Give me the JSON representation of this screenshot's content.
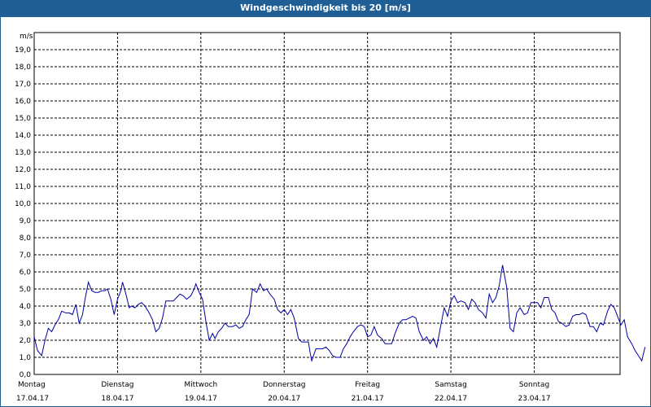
{
  "window": {
    "title": "Windgeschwindigkeit bis 20 [m/s]"
  },
  "chart_data": {
    "type": "line",
    "title": "Windgeschwindigkeit bis 20 [m/s]",
    "ylabel": "m/s",
    "ylim": [
      0,
      20
    ],
    "yticks": [
      "0,0",
      "1,0",
      "2,0",
      "3,0",
      "4,0",
      "5,0",
      "6,0",
      "7,0",
      "8,0",
      "9,0",
      "10,0",
      "11,0",
      "12,0",
      "13,0",
      "14,0",
      "15,0",
      "16,0",
      "17,0",
      "18,0",
      "19,0"
    ],
    "xlim": [
      0,
      7
    ],
    "grid": true,
    "days": [
      {
        "name": "Montag",
        "date": "17.04.17"
      },
      {
        "name": "Dienstag",
        "date": "18.04.17"
      },
      {
        "name": "Mittwoch",
        "date": "19.04.17"
      },
      {
        "name": "Donnerstag",
        "date": "20.04.17"
      },
      {
        "name": "Freitag",
        "date": "21.04.17"
      },
      {
        "name": "Samstag",
        "date": "22.04.17"
      },
      {
        "name": "Sonntag",
        "date": "23.04.17"
      }
    ],
    "series_color": "#0000a0",
    "series": [
      {
        "points": [
          [
            0.0,
            2.2
          ],
          [
            0.04,
            1.4
          ],
          [
            0.09,
            1.1
          ],
          [
            0.13,
            2.0
          ],
          [
            0.17,
            2.7
          ],
          [
            0.21,
            2.5
          ],
          [
            0.25,
            2.9
          ],
          [
            0.29,
            3.2
          ],
          [
            0.33,
            3.7
          ],
          [
            0.38,
            3.6
          ],
          [
            0.42,
            3.6
          ],
          [
            0.46,
            3.5
          ],
          [
            0.5,
            4.1
          ],
          [
            0.54,
            3.0
          ],
          [
            0.58,
            3.5
          ],
          [
            0.61,
            4.4
          ],
          [
            0.65,
            5.4
          ],
          [
            0.69,
            4.9
          ],
          [
            0.73,
            4.8
          ],
          [
            0.77,
            4.8
          ],
          [
            0.81,
            4.9
          ],
          [
            0.85,
            4.9
          ],
          [
            0.88,
            5.0
          ],
          [
            0.92,
            4.4
          ],
          [
            0.96,
            3.5
          ],
          [
            1.0,
            4.4
          ],
          [
            1.04,
            4.9
          ],
          [
            1.06,
            5.4
          ],
          [
            1.1,
            4.7
          ],
          [
            1.14,
            3.9
          ],
          [
            1.17,
            4.0
          ],
          [
            1.21,
            3.9
          ],
          [
            1.25,
            4.1
          ],
          [
            1.29,
            4.2
          ],
          [
            1.33,
            4.0
          ],
          [
            1.38,
            3.6
          ],
          [
            1.42,
            3.2
          ],
          [
            1.46,
            2.5
          ],
          [
            1.5,
            2.7
          ],
          [
            1.54,
            3.3
          ],
          [
            1.58,
            4.3
          ],
          [
            1.63,
            4.3
          ],
          [
            1.67,
            4.3
          ],
          [
            1.71,
            4.5
          ],
          [
            1.75,
            4.7
          ],
          [
            1.79,
            4.6
          ],
          [
            1.83,
            4.4
          ],
          [
            1.88,
            4.6
          ],
          [
            1.92,
            5.0
          ],
          [
            1.94,
            5.3
          ],
          [
            1.98,
            4.8
          ],
          [
            2.02,
            4.4
          ],
          [
            2.06,
            3.1
          ],
          [
            2.1,
            2.0
          ],
          [
            2.14,
            2.4
          ],
          [
            2.17,
            2.1
          ],
          [
            2.21,
            2.5
          ],
          [
            2.25,
            2.7
          ],
          [
            2.29,
            3.0
          ],
          [
            2.33,
            2.8
          ],
          [
            2.38,
            2.8
          ],
          [
            2.42,
            2.9
          ],
          [
            2.46,
            2.7
          ],
          [
            2.5,
            2.8
          ],
          [
            2.54,
            3.2
          ],
          [
            2.58,
            3.5
          ],
          [
            2.62,
            5.0
          ],
          [
            2.67,
            4.8
          ],
          [
            2.71,
            5.3
          ],
          [
            2.75,
            4.9
          ],
          [
            2.79,
            5.0
          ],
          [
            2.83,
            4.7
          ],
          [
            2.88,
            4.4
          ],
          [
            2.92,
            3.8
          ],
          [
            2.96,
            3.6
          ],
          [
            3.0,
            3.8
          ],
          [
            3.04,
            3.5
          ],
          [
            3.08,
            3.8
          ],
          [
            3.12,
            3.3
          ],
          [
            3.17,
            2.1
          ],
          [
            3.21,
            1.9
          ],
          [
            3.25,
            1.9
          ],
          [
            3.29,
            1.9
          ],
          [
            3.31,
            1.3
          ],
          [
            3.33,
            0.8
          ],
          [
            3.38,
            1.5
          ],
          [
            3.42,
            1.5
          ],
          [
            3.46,
            1.5
          ],
          [
            3.5,
            1.6
          ],
          [
            3.54,
            1.4
          ],
          [
            3.58,
            1.1
          ],
          [
            3.62,
            1.0
          ],
          [
            3.67,
            1.0
          ],
          [
            3.71,
            1.5
          ],
          [
            3.75,
            1.8
          ],
          [
            3.79,
            2.2
          ],
          [
            3.83,
            2.5
          ],
          [
            3.88,
            2.8
          ],
          [
            3.92,
            2.9
          ],
          [
            3.96,
            2.8
          ],
          [
            4.0,
            2.2
          ],
          [
            4.04,
            2.3
          ],
          [
            4.08,
            2.8
          ],
          [
            4.12,
            2.3
          ],
          [
            4.17,
            2.1
          ],
          [
            4.21,
            1.8
          ],
          [
            4.25,
            1.8
          ],
          [
            4.29,
            1.8
          ],
          [
            4.33,
            2.4
          ],
          [
            4.38,
            3.0
          ],
          [
            4.42,
            3.2
          ],
          [
            4.46,
            3.2
          ],
          [
            4.5,
            3.3
          ],
          [
            4.54,
            3.4
          ],
          [
            4.58,
            3.3
          ],
          [
            4.62,
            2.5
          ],
          [
            4.67,
            2.0
          ],
          [
            4.71,
            2.2
          ],
          [
            4.75,
            1.8
          ],
          [
            4.79,
            2.1
          ],
          [
            4.83,
            1.6
          ],
          [
            4.88,
            2.9
          ],
          [
            4.92,
            3.9
          ],
          [
            4.96,
            3.4
          ],
          [
            5.0,
            4.3
          ],
          [
            5.04,
            4.6
          ],
          [
            5.08,
            4.2
          ],
          [
            5.12,
            4.3
          ],
          [
            5.17,
            4.2
          ],
          [
            5.21,
            3.8
          ],
          [
            5.25,
            4.4
          ],
          [
            5.29,
            4.2
          ],
          [
            5.33,
            3.8
          ],
          [
            5.38,
            3.6
          ],
          [
            5.42,
            3.3
          ],
          [
            5.46,
            4.7
          ],
          [
            5.5,
            4.2
          ],
          [
            5.54,
            4.5
          ],
          [
            5.58,
            5.2
          ],
          [
            5.62,
            6.4
          ],
          [
            5.67,
            5.1
          ],
          [
            5.71,
            2.7
          ],
          [
            5.75,
            2.5
          ],
          [
            5.79,
            3.6
          ],
          [
            5.83,
            3.9
          ],
          [
            5.88,
            3.5
          ],
          [
            5.92,
            3.6
          ],
          [
            5.96,
            4.2
          ],
          [
            6.0,
            4.2
          ],
          [
            6.04,
            4.2
          ],
          [
            6.08,
            3.9
          ],
          [
            6.12,
            4.5
          ],
          [
            6.17,
            4.5
          ],
          [
            6.21,
            3.8
          ],
          [
            6.25,
            3.6
          ],
          [
            6.29,
            3.1
          ],
          [
            6.33,
            3.0
          ],
          [
            6.38,
            2.8
          ],
          [
            6.42,
            2.9
          ],
          [
            6.46,
            3.4
          ],
          [
            6.5,
            3.5
          ],
          [
            6.54,
            3.5
          ],
          [
            6.58,
            3.6
          ],
          [
            6.62,
            3.5
          ],
          [
            6.67,
            2.8
          ],
          [
            6.71,
            2.8
          ],
          [
            6.75,
            2.5
          ],
          [
            6.79,
            3.0
          ],
          [
            6.83,
            2.9
          ],
          [
            6.88,
            3.7
          ],
          [
            6.92,
            4.1
          ],
          [
            6.96,
            3.9
          ],
          [
            7.0,
            3.4
          ],
          [
            7.04,
            2.9
          ],
          [
            7.08,
            3.2
          ],
          [
            7.12,
            2.2
          ],
          [
            7.17,
            1.8
          ],
          [
            7.21,
            1.4
          ],
          [
            7.25,
            1.1
          ],
          [
            7.29,
            0.8
          ],
          [
            7.33,
            1.6
          ]
        ]
      }
    ]
  }
}
